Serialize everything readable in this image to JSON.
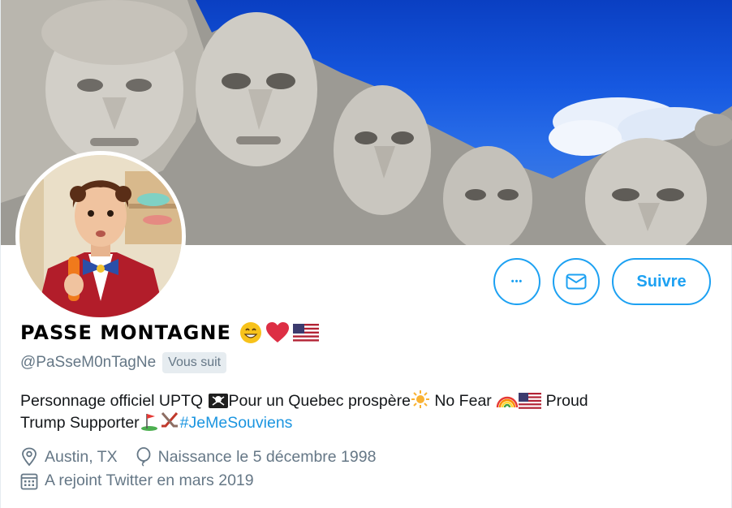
{
  "profile": {
    "display_name": "PASSE MONTAGNE",
    "handle": "@PaSseM0nTagNe",
    "follows_you_label": "Vous suit",
    "bio": {
      "part1": "Personnage officiel UPTQ ",
      "part2": "Pour un Quebec prospère",
      "part3": " No Fear ",
      "part4": " Proud",
      "part5": "Trump Supporter",
      "hashtag": "#JeMeSouviens"
    },
    "location": "Austin, TX",
    "birthday": "Naissance le 5 décembre 1998",
    "joined": "A rejoint Twitter en mars 2019"
  },
  "actions": {
    "more_label": "•••",
    "follow_label": "Suivre"
  },
  "icons": {
    "more": "more-options-icon",
    "message": "envelope-icon",
    "location": "location-pin-icon",
    "birthday": "balloon-icon",
    "calendar": "calendar-icon"
  },
  "colors": {
    "accent": "#1da1f2",
    "hashtag": "#1b95e0",
    "muted": "#657786",
    "badge_bg": "#e6ecf0"
  }
}
